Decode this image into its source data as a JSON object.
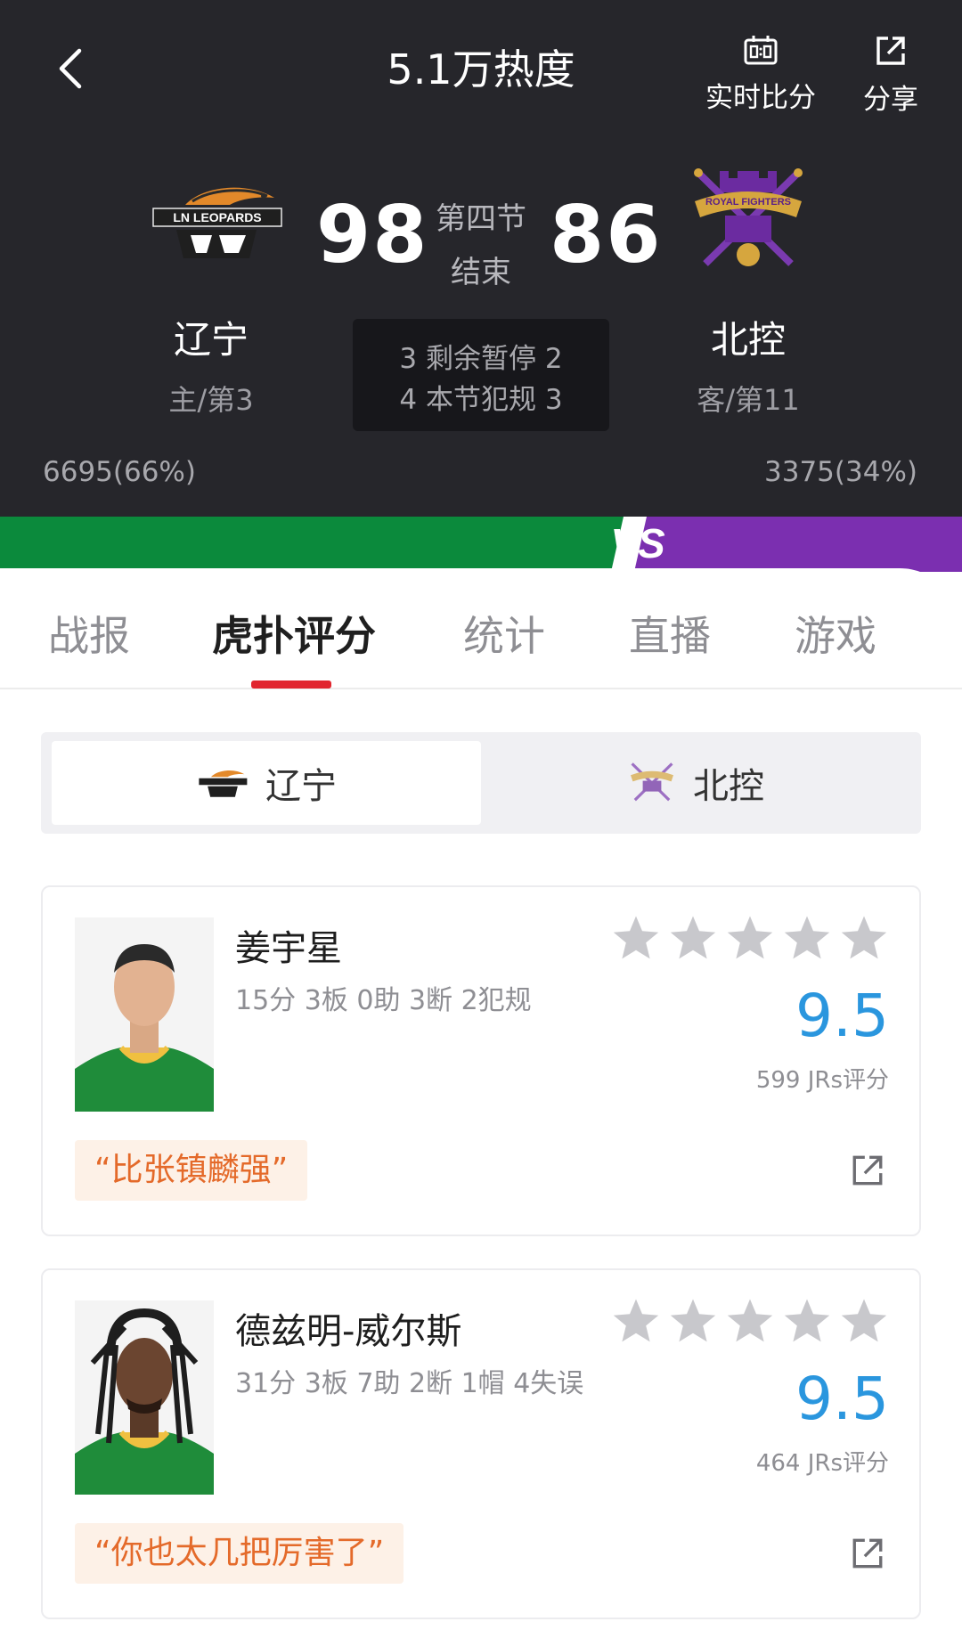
{
  "header": {
    "title": "5.1万热度",
    "back_icon": "chevron-left-icon",
    "actions": [
      {
        "label": "实时比分",
        "icon": "scoreboard-icon"
      },
      {
        "label": "分享",
        "icon": "share-icon"
      }
    ]
  },
  "game": {
    "home": {
      "name": "辽宁",
      "sub": "主/第3",
      "score": "98",
      "support": "6695(66%)",
      "logo": "ln-leopards-logo",
      "logo_text": "LN LEOPARDS",
      "color": "#0b8a3c"
    },
    "away": {
      "name": "北控",
      "sub": "客/第11",
      "score": "86",
      "support": "3375(34%)",
      "logo": "royal-fighters-logo",
      "logo_text": "ROYAL FIGHTERS",
      "color": "#7b2fb0"
    },
    "period": "第四节",
    "status": "结束",
    "timeouts_line": "3 剩余暂停 2",
    "fouls_line": "4 本节犯规 3",
    "vs_mark": "VS"
  },
  "tabs": [
    {
      "label": "战报",
      "active": false
    },
    {
      "label": "虎扑评分",
      "active": true
    },
    {
      "label": "统计",
      "active": false
    },
    {
      "label": "直播",
      "active": false
    },
    {
      "label": "游戏",
      "active": false
    }
  ],
  "team_switch": {
    "home_label": "辽宁",
    "away_label": "北控",
    "selected": "home"
  },
  "players": [
    {
      "name": "姜宇星",
      "stats": "15分 3板 0助 3断 2犯规",
      "rating": "9.5",
      "votes": "599 JRs评分",
      "stars": 5,
      "quote": "“比张镇麟强”"
    },
    {
      "name": "德兹明-威尔斯",
      "stats": "31分 3板 7助 2断 1帽 4失误",
      "rating": "9.5",
      "votes": "464 JRs评分",
      "stars": 5,
      "quote": "“你也太几把厉害了”"
    }
  ],
  "colors": {
    "header_bg": "#26262b",
    "accent_red": "#e1262f",
    "rating_blue": "#2a96de",
    "quote_orange": "#e46a2a",
    "star_gray": "#c8c8cc"
  }
}
